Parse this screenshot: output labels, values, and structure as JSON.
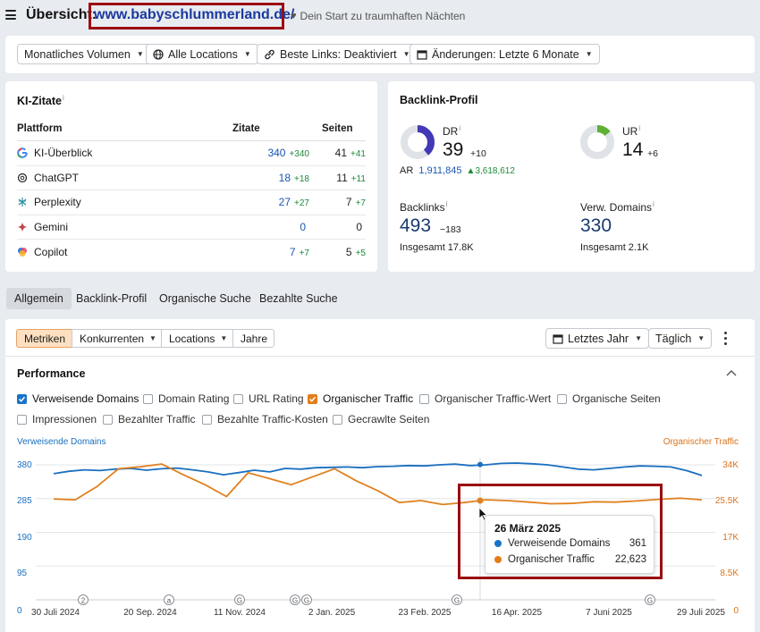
{
  "header": {
    "title": "Übersicht:",
    "domain": "www.babyschlummerland.de/",
    "tagline": "Dein Start zu traumhaften Nächten"
  },
  "filters": [
    {
      "label": "Monatliches Volumen"
    },
    {
      "label": "Alle Locations"
    },
    {
      "label": "Beste Links: Deaktiviert"
    },
    {
      "label": "Änderungen: Letzte 6 Monate"
    }
  ],
  "ki_zitate": {
    "title": "KI-Zitate",
    "info": "i",
    "columns": [
      "Plattform",
      "Zitate",
      "Seiten"
    ],
    "rows": [
      {
        "platform": "KI-Überblick",
        "icon": "google-icon",
        "zitate": "340",
        "zitate_delta": "+340",
        "seiten": "41",
        "seiten_delta": "+41"
      },
      {
        "platform": "ChatGPT",
        "icon": "chatgpt-icon",
        "zitate": "18",
        "zitate_delta": "+18",
        "seiten": "11",
        "seiten_delta": "+11"
      },
      {
        "platform": "Perplexity",
        "icon": "perplexity-icon",
        "zitate": "27",
        "zitate_delta": "+27",
        "seiten": "7",
        "seiten_delta": "+7"
      },
      {
        "platform": "Gemini",
        "icon": "gemini-icon",
        "zitate": "0",
        "zitate_delta": "",
        "seiten": "0",
        "seiten_delta": ""
      },
      {
        "platform": "Copilot",
        "icon": "copilot-icon",
        "zitate": "7",
        "zitate_delta": "+7",
        "seiten": "5",
        "seiten_delta": "+5"
      }
    ]
  },
  "backlink_profile": {
    "title": "Backlink-Profil",
    "dr": {
      "label": "DR",
      "value": "39",
      "delta": "+10",
      "ring_fraction": 0.39
    },
    "ur": {
      "label": "UR",
      "value": "14",
      "delta": "+6",
      "ring_fraction": 0.14
    },
    "ar": {
      "label": "AR",
      "value": "1,911,845",
      "delta": "3,618,612"
    },
    "backlinks": {
      "label": "Backlinks",
      "value": "493",
      "delta": "−183",
      "total": "Insgesamt 17.8K"
    },
    "ref_domains": {
      "label": "Verw. Domains",
      "value": "330",
      "total": "Insgesamt 2.1K"
    }
  },
  "tabs": [
    "Allgemein",
    "Backlink-Profil",
    "Organische Suche",
    "Bezahlte Suche"
  ],
  "segments": [
    {
      "label": "Metriken"
    },
    {
      "label": "Konkurrenten"
    },
    {
      "label": "Locations"
    },
    {
      "label": "Jahre"
    }
  ],
  "period": {
    "label": "Letztes Jahr"
  },
  "granularity": {
    "label": "Täglich"
  },
  "performance": {
    "title": "Performance",
    "checkboxes_row1": [
      {
        "label": "Verweisende Domains",
        "checked": true,
        "color": "#1a73c9"
      },
      {
        "label": "Domain Rating",
        "checked": false
      },
      {
        "label": "URL Rating",
        "checked": false
      },
      {
        "label": "Organischer Traffic",
        "checked": true,
        "color": "#e37d1a"
      },
      {
        "label": "Organischer Traffic-Wert",
        "checked": false
      },
      {
        "label": "Organische Seiten",
        "checked": false
      }
    ],
    "checkboxes_row2": [
      {
        "label": "Impressionen",
        "checked": false
      },
      {
        "label": "Bezahlter Traffic",
        "checked": false
      },
      {
        "label": "Bezahlte Traffic-Kosten",
        "checked": false
      },
      {
        "label": "Gecrawlte Seiten",
        "checked": false
      }
    ]
  },
  "chart_data": {
    "type": "line",
    "left_axis_label": "Verweisende Domains",
    "right_axis_label": "Organischer Traffic",
    "left_ticks": [
      "380",
      "285",
      "190",
      "95",
      "0"
    ],
    "right_ticks": [
      "34K",
      "25.5K",
      "17K",
      "8.5K",
      "0"
    ],
    "x_ticks": [
      "30 Juli 2024",
      "20 Sep. 2024",
      "11 Nov. 2024",
      "2 Jan. 2025",
      "23 Feb. 2025",
      "16 Apr. 2025",
      "7 Juni 2025",
      "29 Juli 2025"
    ],
    "annotations": [
      "2",
      "a",
      "G",
      "G",
      "G",
      "G",
      "G"
    ],
    "series": [
      {
        "name": "Verweisende Domains",
        "color": "#1a6fbf",
        "values": [
          355,
          362,
          366,
          364,
          368,
          370,
          365,
          369,
          371,
          366,
          360,
          352,
          358,
          365,
          360,
          370,
          368,
          372,
          373,
          374,
          372,
          375,
          376,
          378,
          377,
          380,
          382,
          378,
          380,
          384,
          385,
          383,
          380,
          374,
          368,
          366,
          370,
          374,
          377,
          376,
          374,
          364,
          350
        ]
      },
      {
        "name": "Organischer Traffic",
        "color": "#e0811f",
        "values": [
          25400,
          25200,
          28500,
          33000,
          33500,
          34200,
          31500,
          29000,
          26000,
          32000,
          30500,
          29000,
          31000,
          33000,
          30000,
          27500,
          24500,
          25000,
          24000,
          24500,
          25200,
          25000,
          24600,
          24200,
          24300,
          24700,
          24600,
          24900,
          25300,
          25600,
          25200
        ]
      }
    ]
  },
  "tooltip": {
    "date": "26 März 2025",
    "rows": [
      {
        "label": "Verweisende Domains",
        "value": "361",
        "color": "#1a73c9"
      },
      {
        "label": "Organischer Traffic",
        "value": "22,623",
        "color": "#e37d1a"
      }
    ]
  }
}
